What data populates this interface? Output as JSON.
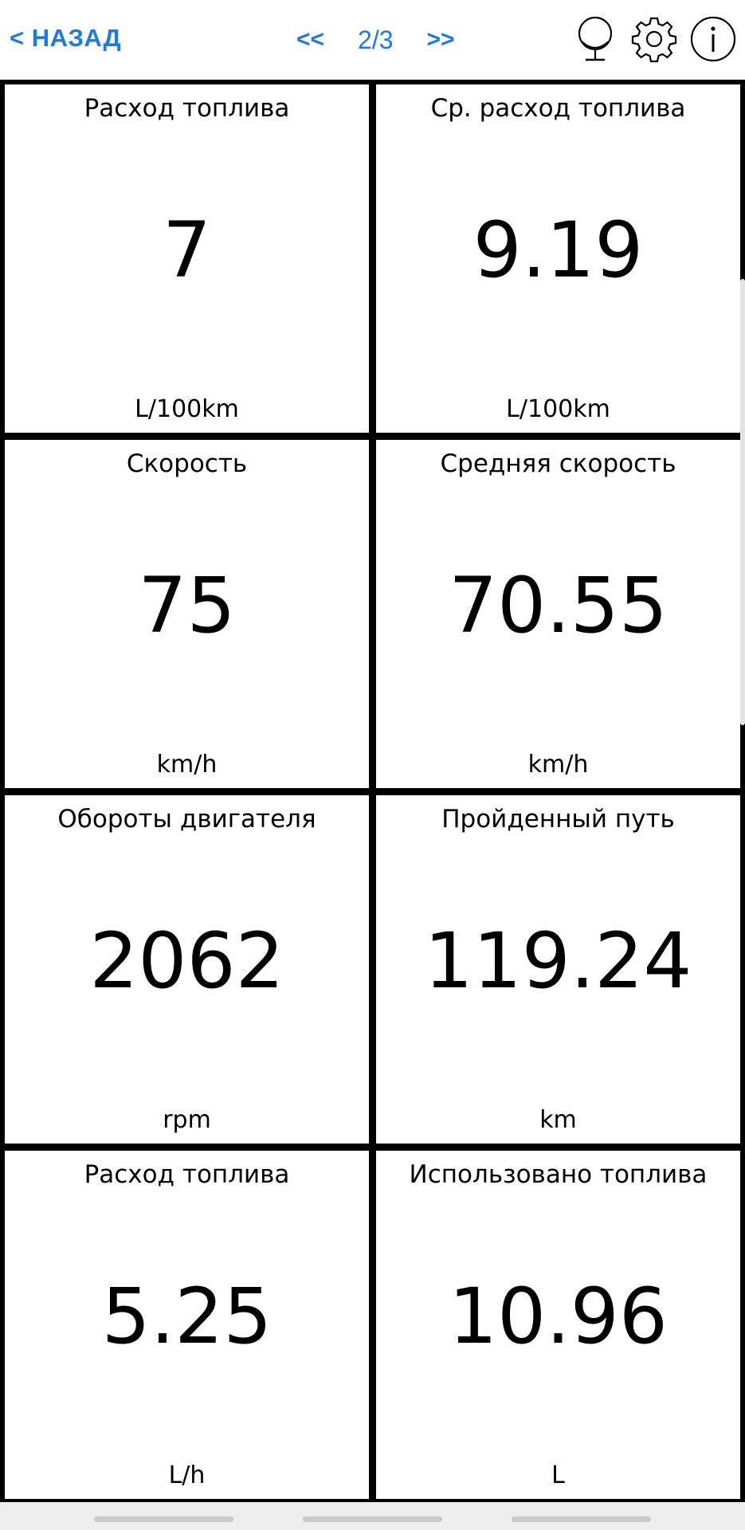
{
  "header": {
    "back_label": "< НАЗАД",
    "prev_label": "<<",
    "page_indicator": "2/3",
    "next_label": ">>",
    "icons": [
      "globe-icon",
      "gear-icon",
      "info-icon"
    ]
  },
  "tiles": [
    {
      "title": "Расход топлива",
      "value": "7",
      "unit": "L/100km"
    },
    {
      "title": "Ср. расход топлива",
      "value": "9.19",
      "unit": "L/100km"
    },
    {
      "title": "Скорость",
      "value": "75",
      "unit": "km/h"
    },
    {
      "title": "Средняя скорость",
      "value": "70.55",
      "unit": "km/h"
    },
    {
      "title": "Обороты двигателя",
      "value": "2062",
      "unit": "rpm"
    },
    {
      "title": "Пройденный путь",
      "value": "119.24",
      "unit": "km"
    },
    {
      "title": "Расход топлива",
      "value": "5.25",
      "unit": "L/h"
    },
    {
      "title": "Использовано топлива",
      "value": "10.96",
      "unit": "L"
    }
  ],
  "colors": {
    "accent": "#1f7ae0",
    "grid_line": "#000000",
    "background": "#ffffff"
  }
}
